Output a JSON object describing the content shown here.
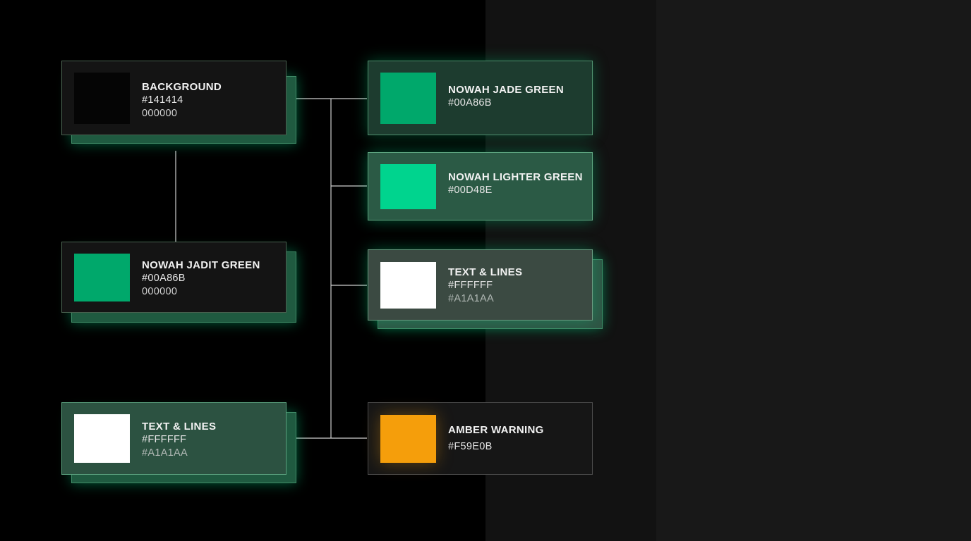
{
  "colors": {
    "connector": "#cfcfcf",
    "page_background": "#000000"
  },
  "cards": {
    "background": {
      "name": "BACKGROUND",
      "hex": "#141414",
      "secondary": "000000",
      "swatch_color": "#050505"
    },
    "jadit_green": {
      "name": "NOWAH JADIT GREEN",
      "hex": "#00A86B",
      "secondary": "000000",
      "swatch_color": "#00A86B"
    },
    "text_lines_left": {
      "name": "TEXT & LINES",
      "hex": "#FFFFFF",
      "secondary": "#A1A1AA",
      "swatch_color": "#FFFFFF"
    },
    "jade_green": {
      "name": "NOWAH JADE GREEN",
      "hex": "#00A86B",
      "swatch_color": "#00A86B"
    },
    "lighter_green": {
      "name": "NOWAH LIGHTER GREEN",
      "hex": "#00D48E",
      "swatch_color": "#00D48E"
    },
    "text_lines_right": {
      "name": "TEXT & LINES",
      "hex": "#FFFFFF",
      "secondary": "#A1A1AA",
      "swatch_color": "#FFFFFF"
    },
    "amber_warning": {
      "name": "AMBER WARNING",
      "hex": "#F59E0B",
      "swatch_color": "#F59E0B"
    }
  }
}
